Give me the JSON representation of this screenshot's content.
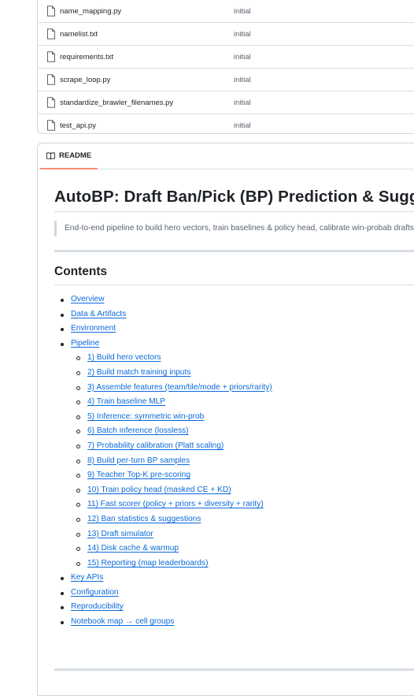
{
  "files": [
    {
      "name": "name_mapping.py",
      "message": "initial"
    },
    {
      "name": "namelist.txt",
      "message": "initial"
    },
    {
      "name": "requirements.txt",
      "message": "initial"
    },
    {
      "name": "scrape_loop.py",
      "message": "initial"
    },
    {
      "name": "standardize_brawler_filenames.py",
      "message": "initial"
    },
    {
      "name": "test_api.py",
      "message": "initial"
    }
  ],
  "readme": {
    "tab_label": "README",
    "title": "AutoBP: Draft Ban/Pick (BP) Prediction & Suggestion",
    "quote": "End-to-end pipeline to build hero vectors, train baselines & policy head, calibrate win-probab drafts, and serve fast next-pick suggestions.",
    "contents_heading": "Contents",
    "toc": {
      "overview": "Overview",
      "data_artifacts": "Data & Artifacts",
      "environment": "Environment",
      "pipeline": "Pipeline",
      "pipeline_items": [
        "1) Build hero vectors",
        "2) Build match training inputs",
        "3) Assemble features (team/tile/mode + priors/rarity)",
        "4) Train baseline MLP",
        "5) Inference: symmetric win-prob",
        "6) Batch inference (lossless)",
        "7) Probability calibration (Platt scaling)",
        "8) Build per-turn BP samples",
        "9) Teacher Top-K pre-scoring",
        "10) Train policy head (masked CE + KD)",
        "11) Fast scorer (policy + priors + diversity + rarity)",
        "12) Ban statistics & suggestions",
        "13) Draft simulator",
        "14) Disk cache & warmup",
        "15) Reporting (map leaderboards)"
      ],
      "key_apis": "Key APIs",
      "configuration": "Configuration",
      "reproducibility": "Reproducibility",
      "notebook_map": "Notebook map → cell groups"
    }
  },
  "colors": {
    "link": "#0969da",
    "tab_underline": "#fd8c73",
    "border": "#d0d7de"
  },
  "icons": {
    "file": "file-icon",
    "readme": "book-icon"
  }
}
